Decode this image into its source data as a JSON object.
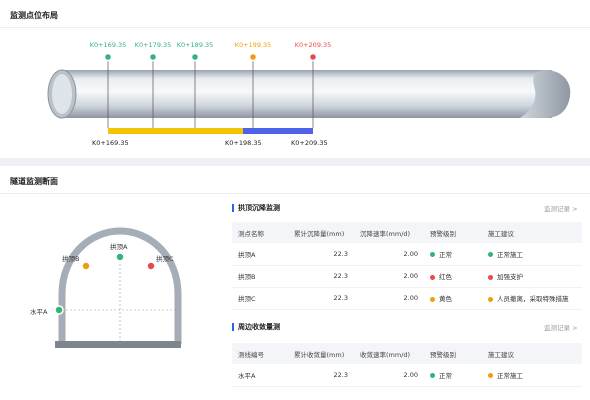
{
  "top": {
    "title": "监测点位布局",
    "markers": [
      {
        "label": "K0+169.35",
        "color": "#33b27a"
      },
      {
        "label": "K0+179.35",
        "color": "#33b27a"
      },
      {
        "label": "K0+189.35",
        "color": "#33b27a"
      },
      {
        "label": "K0+199.35",
        "color": "#f39c12"
      },
      {
        "label": "K0+209.35",
        "color": "#e84a4a"
      }
    ],
    "bar_labels": [
      "K0+169.35",
      "K0+198.35",
      "K0+209.35"
    ],
    "colors": {
      "yellow": "#f5c400",
      "blue": "#4e63ea"
    }
  },
  "bottom": {
    "title": "隧道监测断面",
    "tunnel_labels": {
      "top_a": "拱顶A",
      "top_b": "拱顶B",
      "top_c": "拱顶C",
      "level_a": "水平A"
    },
    "table1": {
      "title": "拱顶沉降监测",
      "link": "监测记录 >",
      "headers": [
        "测点名称",
        "累计沉降量(mm)",
        "沉降速率(mm/d)",
        "预警级别",
        "施工建议"
      ],
      "rows": [
        {
          "name": "拱顶A",
          "total": "22.3",
          "rate": "2.00",
          "level": "正常",
          "level_color": "#33b27a",
          "advice": "正常施工",
          "advice_color": "#33b27a"
        },
        {
          "name": "拱顶B",
          "total": "22.3",
          "rate": "2.00",
          "level": "红色",
          "level_color": "#e84a4a",
          "advice": "加强支护",
          "advice_color": "#e84a4a"
        },
        {
          "name": "拱顶C",
          "total": "22.3",
          "rate": "2.00",
          "level": "黄色",
          "level_color": "#f39c12",
          "advice": "人员撤离，采取特殊措施",
          "advice_color": "#f39c12"
        }
      ]
    },
    "table2": {
      "title": "周边收敛量测",
      "link": "监测记录 >",
      "headers": [
        "测线编号",
        "累计收敛量(mm)",
        "收敛速率(mm/d)",
        "预警级别",
        "施工建议"
      ],
      "rows": [
        {
          "name": "水平A",
          "total": "22.3",
          "rate": "2.00",
          "level": "正常",
          "level_color": "#33b27a",
          "advice": "正常施工",
          "advice_color": "#f39c12"
        }
      ]
    }
  }
}
